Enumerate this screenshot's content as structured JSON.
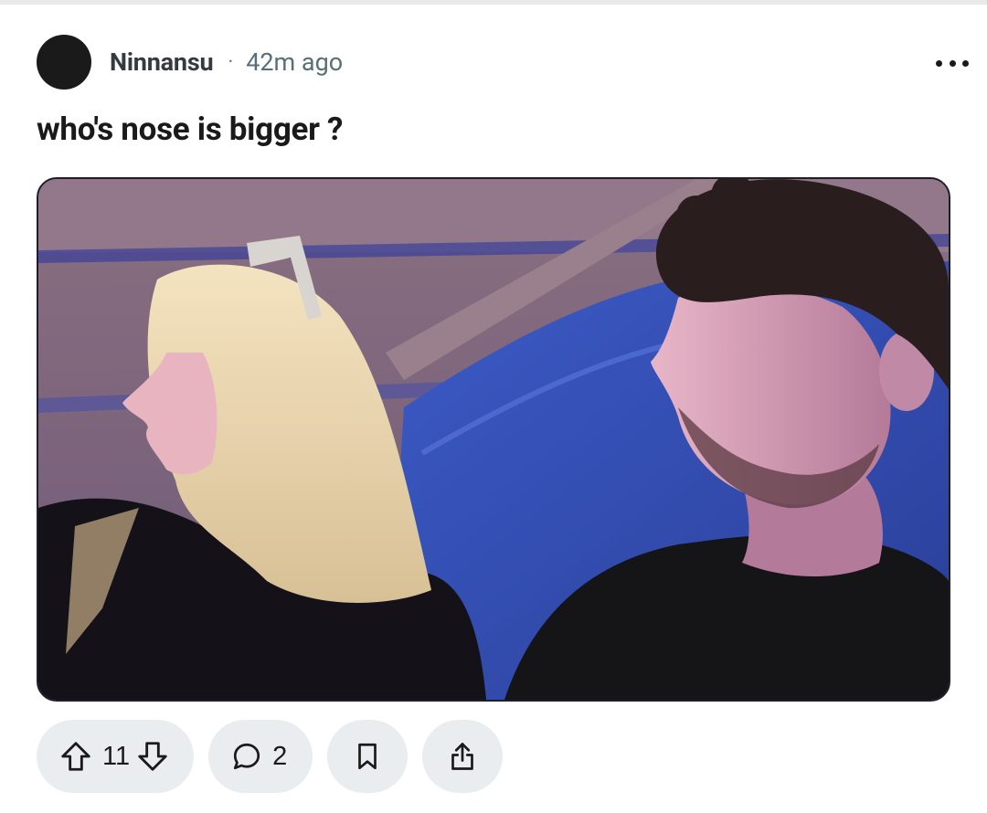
{
  "post": {
    "username": "Ninnansu",
    "separator": "·",
    "time": "42m ago",
    "title": "who's nose is bigger ?",
    "image_alt": "Photo of a blonde woman and a curly-haired man sitting in a blue-lit booth"
  },
  "actions": {
    "upvotes": "11",
    "comments": "2"
  },
  "icons": {
    "more": "more-options-icon",
    "upvote": "upvote-arrow-icon",
    "downvote": "downvote-arrow-icon",
    "comment": "comment-bubble-icon",
    "save": "bookmark-icon",
    "share": "share-icon"
  },
  "colors": {
    "pill_bg": "#eaedef",
    "meta_text": "#576f76",
    "title_text": "#1a1a1b"
  }
}
